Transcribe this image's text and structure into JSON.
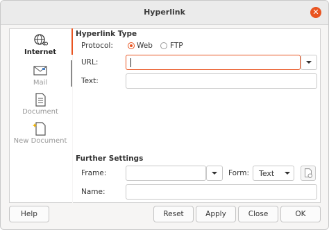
{
  "window": {
    "title": "Hyperlink",
    "close_icon": "close-icon",
    "accent": "#e95420"
  },
  "sidebar": {
    "items": [
      {
        "label": "Internet",
        "icon": "globe-icon",
        "active": true
      },
      {
        "label": "Mail",
        "icon": "mail-icon",
        "active": false
      },
      {
        "label": "Document",
        "icon": "document-icon",
        "active": false
      },
      {
        "label": "New Document",
        "icon": "new-document-icon",
        "active": false
      }
    ]
  },
  "hyperlink_type": {
    "title": "Hyperlink Type",
    "protocol_label": "Protocol:",
    "protocol_options": [
      "Web",
      "FTP"
    ],
    "protocol_selected": "Web",
    "url_label": "URL:",
    "url_value": "",
    "text_label": "Text:",
    "text_value": ""
  },
  "further_settings": {
    "title": "Further Settings",
    "frame_label": "Frame:",
    "frame_value": "",
    "form_label": "Form:",
    "form_value": "Text",
    "events_icon": "events-icon",
    "name_label": "Name:",
    "name_value": ""
  },
  "buttons": {
    "help": "Help",
    "reset": "Reset",
    "apply": "Apply",
    "close": "Close",
    "ok": "OK"
  }
}
